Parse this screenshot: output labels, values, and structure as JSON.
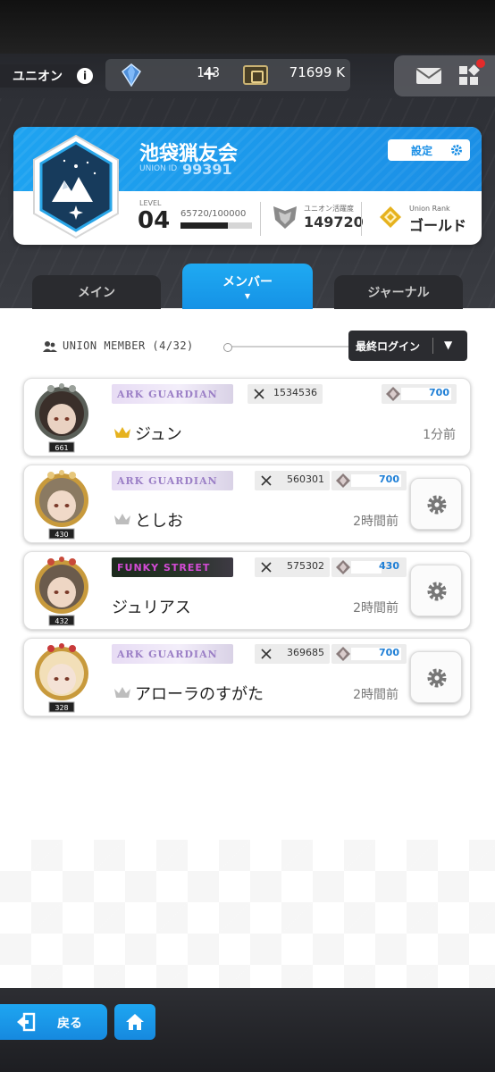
{
  "header": {
    "union_label": "ユニオン",
    "info_icon": "i",
    "gems": "143",
    "gem_plus": "+",
    "credits": "71699 K",
    "icons": [
      "gem-icon",
      "credit-icon",
      "mail-icon",
      "grid-menu-icon"
    ]
  },
  "union": {
    "name": "池袋猟友会",
    "id_label": "UNION ID",
    "id_value": "99391",
    "settings_label": "設定",
    "level_label": "LEVEL",
    "level": "04",
    "exp_text": "65720/100000",
    "exp_progress": 0.6572,
    "activity_label": "ユニオン活躍度",
    "activity_value": "149720",
    "rank_label": "Union Rank",
    "rank_value": "ゴールド"
  },
  "tabs": [
    {
      "label": "メイン",
      "active": false
    },
    {
      "label": "メンバー",
      "active": true,
      "indicator": "▼"
    },
    {
      "label": "ジャーナル",
      "active": false
    }
  ],
  "members_section": {
    "title": "UNION MEMBER (4/32)",
    "sort_label": "最終ログイン",
    "sort_arrow": "▼"
  },
  "members": [
    {
      "name": "ジュン",
      "level": "661",
      "banner": "ARK GUARDIAN",
      "power": "1534536",
      "gems": "700",
      "gem_fill": 1.0,
      "last_login": "1分前",
      "crown": "gold",
      "has_settings": false
    },
    {
      "name": "としお",
      "level": "430",
      "banner": "ARK GUARDIAN",
      "power": "560301",
      "gems": "700",
      "gem_fill": 1.0,
      "last_login": "2時間前",
      "crown": "silver",
      "has_settings": true
    },
    {
      "name": "ジュリアス",
      "level": "432",
      "banner": "FUNKY STREET",
      "power": "575302",
      "gems": "430",
      "gem_fill": 0.6,
      "last_login": "2時間前",
      "crown": "none",
      "has_settings": true
    },
    {
      "name": "アローラのすがた",
      "level": "328",
      "banner": "ARK GUARDIAN",
      "power": "369685",
      "gems": "700",
      "gem_fill": 1.0,
      "last_login": "2時間前",
      "crown": "silver",
      "has_settings": true
    }
  ],
  "footer": {
    "back_label": "戻る",
    "icons": [
      "exit-icon",
      "home-icon"
    ]
  },
  "colors": {
    "accent_blue": "#1b8fe6",
    "gold": "#e6b21e",
    "dark": "#2b2c30"
  }
}
